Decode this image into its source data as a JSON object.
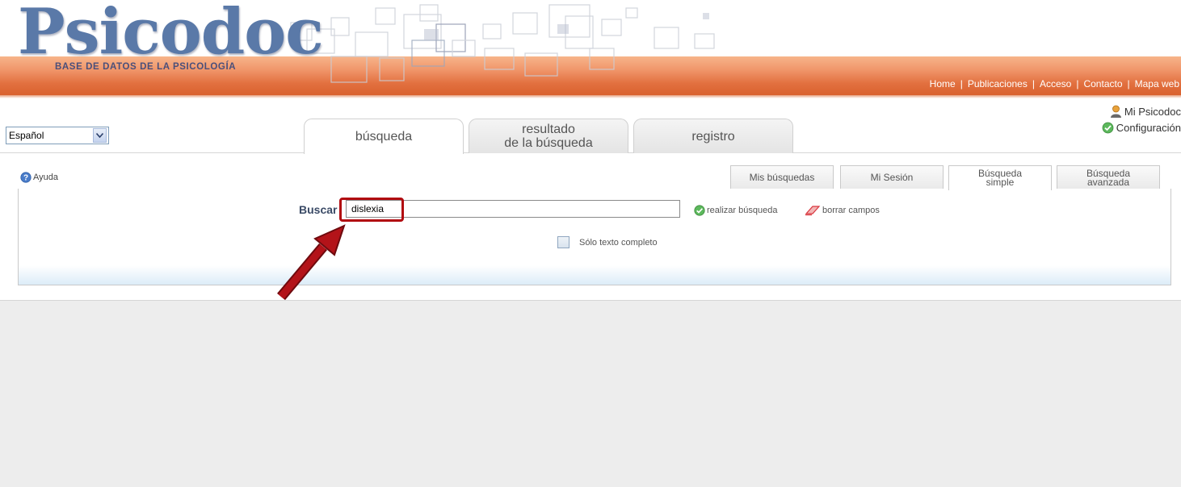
{
  "header": {
    "logo": "Psicodoc",
    "logo_subtitle": "BASE DE DATOS DE LA PSICOLOGÍA",
    "nav": [
      "Home",
      "Publicaciones",
      "Acceso",
      "Contacto",
      "Mapa web"
    ]
  },
  "user": {
    "my_psicodoc": "Mi Psicodoc",
    "configuracion": "Configuración"
  },
  "language": {
    "selected": "Español"
  },
  "main_tabs": [
    {
      "label": "búsqueda"
    },
    {
      "line1": "resultado",
      "line2": "de la búsqueda"
    },
    {
      "label": "registro"
    }
  ],
  "help": {
    "label": "Ayuda"
  },
  "sub_tabs": [
    {
      "label": "Mis búsquedas"
    },
    {
      "label": "Mi Sesión"
    },
    {
      "line1": "Búsqueda",
      "line2": "simple"
    },
    {
      "line1": "Búsqueda",
      "line2": "avanzada"
    }
  ],
  "search": {
    "label": "Buscar",
    "value": "dislexia",
    "submit": "realizar búsqueda",
    "clear": "borrar campos",
    "fulltext_label": "Sólo texto completo"
  },
  "colors": {
    "header_band": "#e2703f",
    "logo": "#5a79a8",
    "highlight": "#b10a10"
  }
}
